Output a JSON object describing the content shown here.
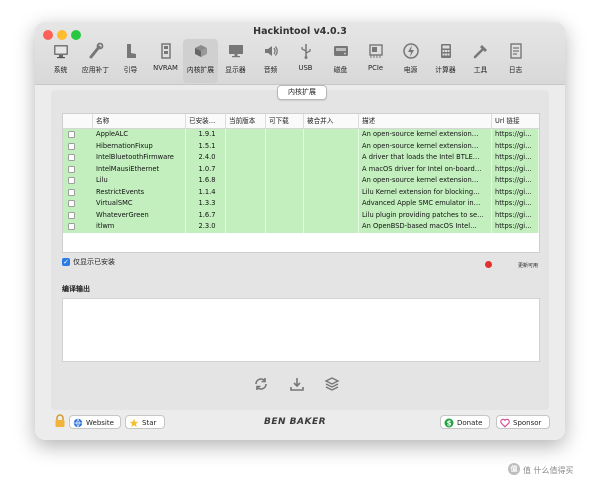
{
  "window": {
    "title": "Hackintool v4.0.3"
  },
  "toolbar": {
    "items": [
      {
        "label": "系统",
        "icon": "computer-icon"
      },
      {
        "label": "应用补丁",
        "icon": "wrench-icon"
      },
      {
        "label": "引导",
        "icon": "boot-icon"
      },
      {
        "label": "NVRAM",
        "icon": "memory-icon"
      },
      {
        "label": "内核扩展",
        "icon": "kext-icon"
      },
      {
        "label": "显示器",
        "icon": "display-icon"
      },
      {
        "label": "音频",
        "icon": "speaker-icon"
      },
      {
        "label": "USB",
        "icon": "usb-icon"
      },
      {
        "label": "磁盘",
        "icon": "disk-icon"
      },
      {
        "label": "PCIe",
        "icon": "pcie-icon"
      },
      {
        "label": "电源",
        "icon": "power-icon"
      },
      {
        "label": "计算器",
        "icon": "calculator-icon"
      },
      {
        "label": "工具",
        "icon": "tools-icon"
      },
      {
        "label": "日志",
        "icon": "log-icon"
      }
    ]
  },
  "segment": {
    "label": "内核扩展"
  },
  "table": {
    "headers": [
      "",
      "名称",
      "已安装…",
      "当前版本",
      "可下载",
      "被合并入",
      "描述",
      "Url 链接"
    ],
    "rows": [
      {
        "name": "AppleALC",
        "installed": "1.9.1",
        "desc": "An open-source kernel extension…",
        "url": "https://gi…"
      },
      {
        "name": "HibernationFixup",
        "installed": "1.5.1",
        "desc": "An open-source kernel extension…",
        "url": "https://gi…"
      },
      {
        "name": "IntelBluetoothFirmware",
        "installed": "2.4.0",
        "desc": "A driver that loads the Intel BTLE…",
        "url": "https://gi…"
      },
      {
        "name": "IntelMausiEthernet",
        "installed": "1.0.7",
        "desc": "A macOS driver for Intel on-board…",
        "url": "https://gi…"
      },
      {
        "name": "Lilu",
        "installed": "1.6.8",
        "desc": "An open-source kernel extension…",
        "url": "https://gi…"
      },
      {
        "name": "RestrictEvents",
        "installed": "1.1.4",
        "desc": "Lilu Kernel extension for blocking…",
        "url": "https://gi…"
      },
      {
        "name": "VirtualSMC",
        "installed": "1.3.3",
        "desc": "Advanced Apple SMC emulator in…",
        "url": "https://gi…"
      },
      {
        "name": "WhateverGreen",
        "installed": "1.6.7",
        "desc": "Lilu plugin providing patches to se…",
        "url": "https://gi…"
      },
      {
        "name": "itlwm",
        "installed": "2.3.0",
        "desc": "An OpenBSD-based macOS Intel…",
        "url": "https://gi…"
      }
    ]
  },
  "filter": {
    "label": "仅显示已安装",
    "checked": true
  },
  "update": {
    "label": "更新可用"
  },
  "output": {
    "label": "编译输出"
  },
  "footer": {
    "website": "Website",
    "star": "Star",
    "brand": "BEN BAKER",
    "donate": "Donate",
    "sponsor": "Sponsor"
  },
  "watermark": {
    "text": "值 什么值得买"
  }
}
